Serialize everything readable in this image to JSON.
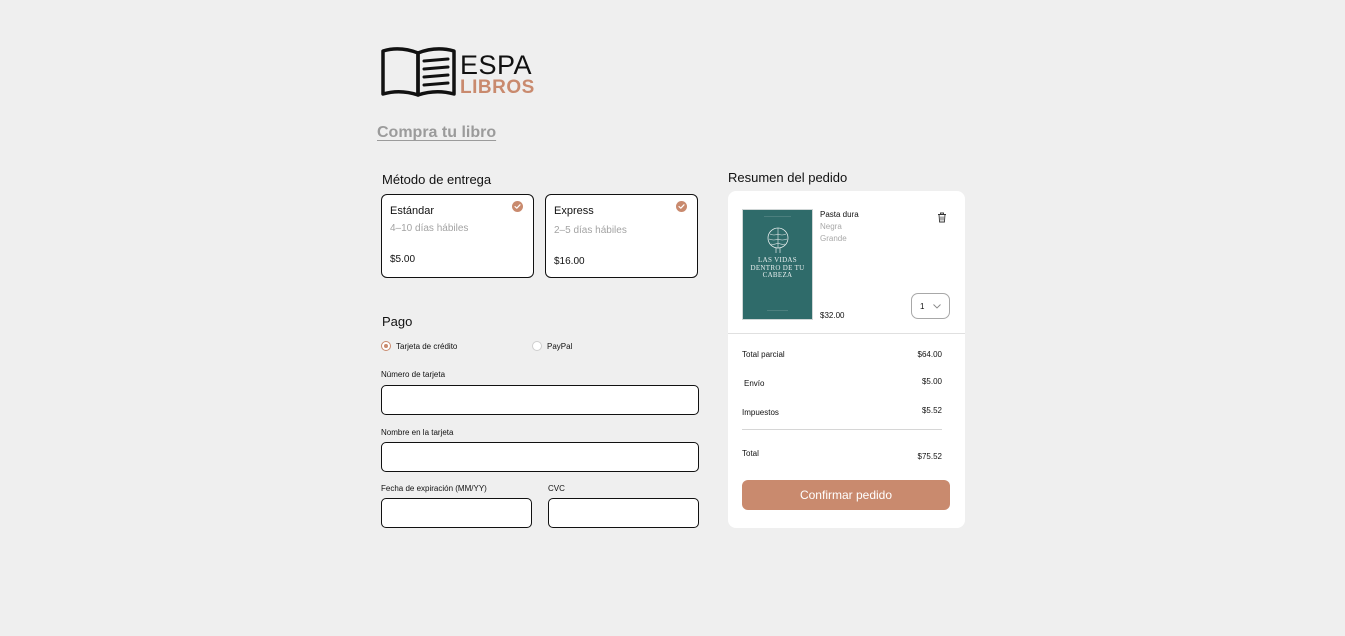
{
  "brand": {
    "line1": "ESPA",
    "line2": "LIBROS",
    "accent": "#c98a6e"
  },
  "page_title": "Compra tu libro",
  "delivery": {
    "title": "Método de entrega",
    "options": [
      {
        "name": "Estándar",
        "days": "4–10 días hábiles",
        "price": "$5.00",
        "icon": "check-circle-icon"
      },
      {
        "name": "Express",
        "days": "2–5 días hábiles",
        "price": "$16.00",
        "icon": "check-circle-icon"
      }
    ]
  },
  "payment": {
    "title": "Pago",
    "methods": [
      {
        "label": "Tarjeta de crédito",
        "selected": true
      },
      {
        "label": "PayPal",
        "selected": false
      }
    ],
    "fields": {
      "card_number": {
        "label": "Número de tarjeta",
        "value": "",
        "placeholder": ""
      },
      "card_name": {
        "label": "Nombre en la tarjeta",
        "value": "",
        "placeholder": ""
      },
      "expiry": {
        "label": "Fecha de expiración (MM/YY)",
        "value": "",
        "placeholder": ""
      },
      "cvc": {
        "label": "CVC",
        "value": "",
        "placeholder": ""
      }
    }
  },
  "summary": {
    "title": "Resumen del pedido",
    "product": {
      "cover_title": "LAS VIDAS DENTRO DE TU CABEZA",
      "format": "Pasta dura",
      "options": [
        "Negra",
        "Grande"
      ],
      "price": "$32.00",
      "quantity": "1"
    },
    "rows": [
      {
        "label": "Total parcial",
        "value": "$64.00"
      },
      {
        "label": "Envío",
        "value": "$5.00"
      },
      {
        "label": "Impuestos",
        "value": "$5.52"
      }
    ],
    "total": {
      "label": "Total",
      "value": "$75.52"
    },
    "confirm_label": "Confirmar pedido"
  }
}
